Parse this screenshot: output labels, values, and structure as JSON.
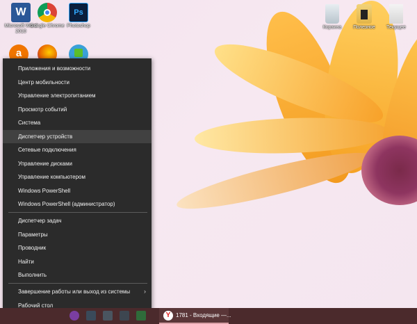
{
  "desktop_icons": [
    {
      "name": "word-icon",
      "label": "Microsoft Word 2010",
      "color": "#2b5797",
      "glyph": "W"
    },
    {
      "name": "chrome-icon",
      "label": "Google Chrome",
      "color": "#db4437",
      "glyph": ""
    },
    {
      "name": "photoshop-icon",
      "label": "Photoshop",
      "color": "#0b1e3c",
      "glyph": "Ps"
    },
    {
      "name": "avast-icon",
      "label": "",
      "color": "#f07500",
      "glyph": "a"
    },
    {
      "name": "firefox-icon",
      "label": "",
      "color": "#e66000",
      "glyph": ""
    },
    {
      "name": "downloader-icon",
      "label": "",
      "color": "#3aa0d8",
      "glyph": ""
    }
  ],
  "right_icons": [
    {
      "name": "recycle-bin-icon",
      "label": "Корзина"
    },
    {
      "name": "folder-icon",
      "label": "Полезное"
    },
    {
      "name": "file-icon",
      "label": "Текущее"
    }
  ],
  "menu": {
    "group1": [
      "Приложения и возможности",
      "Центр мобильности",
      "Управление электропитанием",
      "Просмотр событий",
      "Система",
      "Диспетчер устройств",
      "Сетевые подключения",
      "Управление дисками",
      "Управление компьютером",
      "Windows PowerShell",
      "Windows PowerShell (администратор)"
    ],
    "group2": [
      "Диспетчер задач",
      "Параметры",
      "Проводник",
      "Найти",
      "Выполнить"
    ],
    "group3": [
      "Завершение работы или выход из системы",
      "Рабочий стол"
    ],
    "selected": "Диспетчер устройств",
    "submenu_arrow": "›"
  },
  "taskbar": {
    "yandex_task_label": "1781 - Входящие —...",
    "accent": "#4b2a2c"
  }
}
